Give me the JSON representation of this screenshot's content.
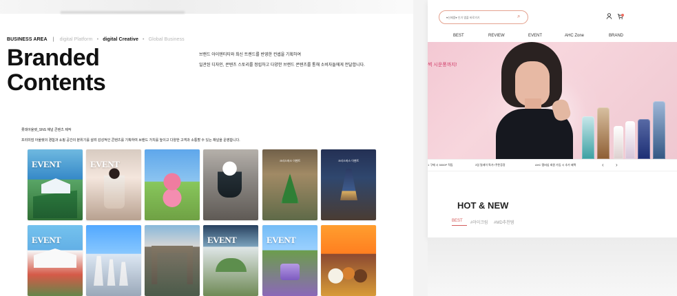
{
  "left": {
    "nav": {
      "business_area": "BUSINESS AREA",
      "separator": "|",
      "digital_platform": "digital Platform",
      "digital_creative": "digital Creative",
      "global_business": "Global Business"
    },
    "title_lines": [
      "Branded",
      "Contents"
    ],
    "intro_lines": [
      "브랜드 아이덴티티와 최신 트렌드를 반영한 컨셉을 기획하여",
      "일관된 디자인, 콘텐츠 스토리를 정립하고 다양한 브랜드 콘텐츠를 통해 소비자들에게 전달합니다."
    ],
    "section_lines": [
      "롯데아울렛_SNS 채널 콘텐츠 제작",
      "프리미엄 아울렛의 경험과 쇼핑 공간의 분위기를 살려 감성적인 콘텐츠를 기획하여 브랜드 가치를 높이고 다양한 고객과 소통할 수 있는 채널을 운영합니다."
    ],
    "thumbnails": [
      {
        "label": "EVENT"
      },
      {
        "label": "EVENT"
      },
      {
        "label": ""
      },
      {
        "label": ""
      },
      {
        "label": "크리스마스 이벤트"
      },
      {
        "label": "크리스마스 이벤트"
      },
      {
        "label": "EVENT"
      },
      {
        "label": ""
      },
      {
        "label": ""
      },
      {
        "label": "EVENT"
      },
      {
        "label": "EVENT"
      },
      {
        "label": ""
      }
    ]
  },
  "right": {
    "search": {
      "placeholder": "♥신제품♥ 인기 앰플 바로가기"
    },
    "nav": [
      "BEST",
      "REVIEW",
      "EVENT",
      "AHC Zone",
      "BRAND"
    ],
    "hero_copy": "썩 시운풍까지!",
    "promo_items": [
      "1 구매 시 5000P 적립",
      "3일 릴레이 특가+쿠폰증정",
      "AHC 멤버십 회원 가입 시 추가 혜택"
    ],
    "promo_prev": "‹",
    "promo_next": "›",
    "hot_new": "HOT & NEW",
    "tabs": [
      "BEST",
      "#아이크림",
      "#MD추천템"
    ]
  }
}
